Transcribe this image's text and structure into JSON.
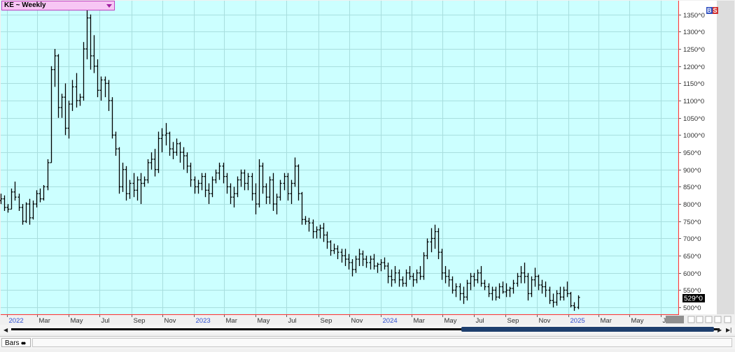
{
  "symbol_selector": {
    "label": "KE ~ Weekly"
  },
  "bs_buttons": {
    "b": "B",
    "s": "S"
  },
  "bottom_tab": {
    "label": "Bars"
  },
  "last_price_label": "529^0",
  "colors": {
    "plot_bg": "#ccffff",
    "grid": "#a8dede",
    "bars": "#000000",
    "axis_line": "#ff3030",
    "year_label": "#2f4fd0",
    "scroll_thumb": "#1e3f6e"
  },
  "chart_data": {
    "type": "ohlc-bar",
    "title": "",
    "xlabel": "",
    "ylabel": "",
    "ylim": [
      480,
      1390
    ],
    "xlim": [
      "2021-12-20",
      "2025-08-04"
    ],
    "grid": true,
    "price_axis_side": "right",
    "y_ticks": [
      "500^0",
      "550^0",
      "600^0",
      "650^0",
      "700^0",
      "750^0",
      "800^0",
      "850^0",
      "900^0",
      "950^0",
      "1000^0",
      "1050^0",
      "1100^0",
      "1150^0",
      "1200^0",
      "1250^0",
      "1300^0",
      "1350^0"
    ],
    "y_tick_values": [
      500,
      550,
      600,
      650,
      700,
      750,
      800,
      850,
      900,
      950,
      1000,
      1050,
      1100,
      1150,
      1200,
      1250,
      1300,
      1350
    ],
    "x_labels": [
      {
        "text": "2022",
        "date": "2022-01-01",
        "year": true
      },
      {
        "text": "Mar",
        "date": "2022-03-01",
        "year": false
      },
      {
        "text": "May",
        "date": "2022-05-01",
        "year": false
      },
      {
        "text": "Jul",
        "date": "2022-07-01",
        "year": false
      },
      {
        "text": "Sep",
        "date": "2022-09-01",
        "year": false
      },
      {
        "text": "Nov",
        "date": "2022-11-01",
        "year": false
      },
      {
        "text": "2023",
        "date": "2023-01-01",
        "year": true
      },
      {
        "text": "Mar",
        "date": "2023-03-01",
        "year": false
      },
      {
        "text": "May",
        "date": "2023-05-01",
        "year": false
      },
      {
        "text": "Jul",
        "date": "2023-07-01",
        "year": false
      },
      {
        "text": "Sep",
        "date": "2023-09-01",
        "year": false
      },
      {
        "text": "Nov",
        "date": "2023-11-01",
        "year": false
      },
      {
        "text": "2024",
        "date": "2024-01-01",
        "year": true
      },
      {
        "text": "Mar",
        "date": "2024-03-01",
        "year": false
      },
      {
        "text": "May",
        "date": "2024-05-01",
        "year": false
      },
      {
        "text": "Jul",
        "date": "2024-07-01",
        "year": false
      },
      {
        "text": "Sep",
        "date": "2024-09-01",
        "year": false
      },
      {
        "text": "Nov",
        "date": "2024-11-01",
        "year": false
      },
      {
        "text": "2025",
        "date": "2025-01-01",
        "year": true
      },
      {
        "text": "Mar",
        "date": "2025-03-01",
        "year": false
      },
      {
        "text": "May",
        "date": "2025-05-01",
        "year": false
      },
      {
        "text": "Jul",
        "date": "2025-07-01",
        "year": false
      }
    ],
    "series": [
      {
        "start": "2021-12-20",
        "interval_days": 7,
        "ohlc": [
          [
            810,
            830,
            800,
            815
          ],
          [
            815,
            825,
            780,
            790
          ],
          [
            790,
            800,
            775,
            785
          ],
          [
            785,
            845,
            785,
            835
          ],
          [
            835,
            865,
            810,
            820
          ],
          [
            820,
            830,
            780,
            790
          ],
          [
            790,
            800,
            740,
            750
          ],
          [
            750,
            805,
            745,
            800
          ],
          [
            800,
            815,
            740,
            760
          ],
          [
            760,
            810,
            755,
            800
          ],
          [
            800,
            840,
            790,
            830
          ],
          [
            830,
            845,
            805,
            815
          ],
          [
            815,
            855,
            810,
            850
          ],
          [
            850,
            930,
            840,
            920
          ],
          [
            920,
            1200,
            920,
            1190
          ],
          [
            1190,
            1250,
            1140,
            1230
          ],
          [
            1230,
            1235,
            1050,
            1080
          ],
          [
            1080,
            1120,
            1050,
            1110
          ],
          [
            1110,
            1150,
            1000,
            1020
          ],
          [
            1020,
            1100,
            990,
            1090
          ],
          [
            1090,
            1160,
            1070,
            1140
          ],
          [
            1140,
            1180,
            1080,
            1100
          ],
          [
            1100,
            1120,
            1085,
            1110
          ],
          [
            1110,
            1270,
            1100,
            1250
          ],
          [
            1250,
            1380,
            1220,
            1340
          ],
          [
            1340,
            1350,
            1190,
            1230
          ],
          [
            1230,
            1290,
            1180,
            1200
          ],
          [
            1200,
            1220,
            1110,
            1130
          ],
          [
            1130,
            1170,
            1100,
            1160
          ],
          [
            1160,
            1170,
            1110,
            1150
          ],
          [
            1150,
            1160,
            1070,
            1100
          ],
          [
            1100,
            1110,
            990,
            1000
          ],
          [
            1000,
            1010,
            940,
            960
          ],
          [
            960,
            965,
            830,
            850
          ],
          [
            850,
            920,
            835,
            900
          ],
          [
            900,
            910,
            810,
            830
          ],
          [
            830,
            870,
            815,
            860
          ],
          [
            860,
            890,
            820,
            840
          ],
          [
            840,
            880,
            810,
            870
          ],
          [
            870,
            890,
            800,
            860
          ],
          [
            860,
            880,
            850,
            870
          ],
          [
            870,
            930,
            860,
            920
          ],
          [
            920,
            950,
            900,
            930
          ],
          [
            930,
            960,
            880,
            900
          ],
          [
            900,
            1010,
            890,
            990
          ],
          [
            990,
            1020,
            950,
            1000
          ],
          [
            1000,
            1035,
            970,
            1005
          ],
          [
            1005,
            1010,
            940,
            960
          ],
          [
            960,
            980,
            930,
            950
          ],
          [
            950,
            990,
            940,
            975
          ],
          [
            975,
            980,
            920,
            950
          ],
          [
            950,
            965,
            900,
            940
          ],
          [
            940,
            950,
            890,
            910
          ],
          [
            910,
            920,
            850,
            870
          ],
          [
            870,
            880,
            830,
            850
          ],
          [
            850,
            870,
            830,
            860
          ],
          [
            860,
            890,
            840,
            880
          ],
          [
            880,
            890,
            820,
            840
          ],
          [
            840,
            860,
            800,
            830
          ],
          [
            830,
            880,
            820,
            870
          ],
          [
            870,
            900,
            860,
            890
          ],
          [
            890,
            920,
            870,
            910
          ],
          [
            910,
            920,
            860,
            880
          ],
          [
            880,
            890,
            830,
            850
          ],
          [
            850,
            860,
            800,
            820
          ],
          [
            820,
            850,
            790,
            830
          ],
          [
            830,
            880,
            820,
            870
          ],
          [
            870,
            900,
            850,
            890
          ],
          [
            890,
            900,
            840,
            860
          ],
          [
            860,
            890,
            840,
            880
          ],
          [
            880,
            890,
            810,
            830
          ],
          [
            830,
            860,
            770,
            800
          ],
          [
            800,
            930,
            790,
            910
          ],
          [
            910,
            920,
            830,
            850
          ],
          [
            850,
            860,
            800,
            820
          ],
          [
            820,
            880,
            800,
            870
          ],
          [
            870,
            890,
            780,
            800
          ],
          [
            800,
            830,
            770,
            820
          ],
          [
            820,
            870,
            810,
            860
          ],
          [
            860,
            890,
            840,
            880
          ],
          [
            880,
            890,
            810,
            830
          ],
          [
            830,
            870,
            800,
            860
          ],
          [
            860,
            935,
            850,
            910
          ],
          [
            910,
            915,
            810,
            830
          ],
          [
            830,
            835,
            740,
            755
          ],
          [
            755,
            765,
            740,
            750
          ],
          [
            750,
            760,
            720,
            745
          ],
          [
            745,
            755,
            700,
            720
          ],
          [
            720,
            735,
            700,
            725
          ],
          [
            725,
            740,
            700,
            730
          ],
          [
            730,
            745,
            690,
            710
          ],
          [
            710,
            720,
            670,
            690
          ],
          [
            690,
            695,
            650,
            665
          ],
          [
            665,
            685,
            655,
            670
          ],
          [
            670,
            680,
            640,
            660
          ],
          [
            660,
            670,
            630,
            650
          ],
          [
            650,
            670,
            620,
            640
          ],
          [
            640,
            655,
            610,
            630
          ],
          [
            630,
            640,
            590,
            610
          ],
          [
            610,
            650,
            600,
            640
          ],
          [
            640,
            670,
            620,
            655
          ],
          [
            655,
            665,
            620,
            640
          ],
          [
            640,
            650,
            615,
            630
          ],
          [
            630,
            650,
            610,
            640
          ],
          [
            640,
            655,
            610,
            620
          ],
          [
            620,
            630,
            600,
            625
          ],
          [
            625,
            640,
            605,
            630
          ],
          [
            630,
            645,
            610,
            620
          ],
          [
            620,
            630,
            570,
            590
          ],
          [
            590,
            610,
            560,
            580
          ],
          [
            580,
            620,
            570,
            600
          ],
          [
            600,
            610,
            560,
            580
          ],
          [
            580,
            590,
            560,
            570
          ],
          [
            570,
            610,
            560,
            600
          ],
          [
            600,
            620,
            580,
            590
          ],
          [
            590,
            600,
            560,
            580
          ],
          [
            580,
            610,
            570,
            600
          ],
          [
            600,
            620,
            580,
            590
          ],
          [
            590,
            660,
            580,
            650
          ],
          [
            650,
            700,
            640,
            690
          ],
          [
            690,
            730,
            660,
            700
          ],
          [
            700,
            740,
            670,
            720
          ],
          [
            720,
            730,
            640,
            660
          ],
          [
            660,
            670,
            580,
            600
          ],
          [
            600,
            620,
            570,
            590
          ],
          [
            590,
            610,
            560,
            580
          ],
          [
            580,
            590,
            540,
            550
          ],
          [
            550,
            570,
            530,
            560
          ],
          [
            560,
            570,
            520,
            540
          ],
          [
            540,
            560,
            510,
            530
          ],
          [
            530,
            580,
            520,
            570
          ],
          [
            570,
            600,
            550,
            590
          ],
          [
            590,
            600,
            560,
            580
          ],
          [
            580,
            610,
            570,
            600
          ],
          [
            600,
            620,
            560,
            570
          ],
          [
            570,
            580,
            550,
            560
          ],
          [
            560,
            570,
            530,
            540
          ],
          [
            540,
            560,
            520,
            550
          ],
          [
            550,
            560,
            520,
            530
          ],
          [
            530,
            570,
            525,
            560
          ],
          [
            560,
            575,
            540,
            545
          ],
          [
            545,
            570,
            530,
            550
          ],
          [
            550,
            560,
            530,
            555
          ],
          [
            555,
            580,
            540,
            570
          ],
          [
            570,
            600,
            560,
            590
          ],
          [
            590,
            620,
            570,
            600
          ],
          [
            600,
            630,
            570,
            590
          ],
          [
            590,
            600,
            520,
            540
          ],
          [
            540,
            590,
            530,
            580
          ],
          [
            580,
            615,
            560,
            590
          ],
          [
            590,
            595,
            550,
            565
          ],
          [
            565,
            580,
            540,
            560
          ],
          [
            560,
            575,
            530,
            550
          ],
          [
            550,
            560,
            510,
            520
          ],
          [
            520,
            540,
            500,
            515
          ],
          [
            515,
            550,
            505,
            540
          ],
          [
            540,
            560,
            520,
            530
          ],
          [
            530,
            560,
            520,
            550
          ],
          [
            550,
            575,
            530,
            540
          ],
          [
            540,
            545,
            500,
            505
          ],
          [
            505,
            515,
            490,
            500
          ],
          [
            500,
            535,
            495,
            529
          ]
        ]
      }
    ]
  }
}
